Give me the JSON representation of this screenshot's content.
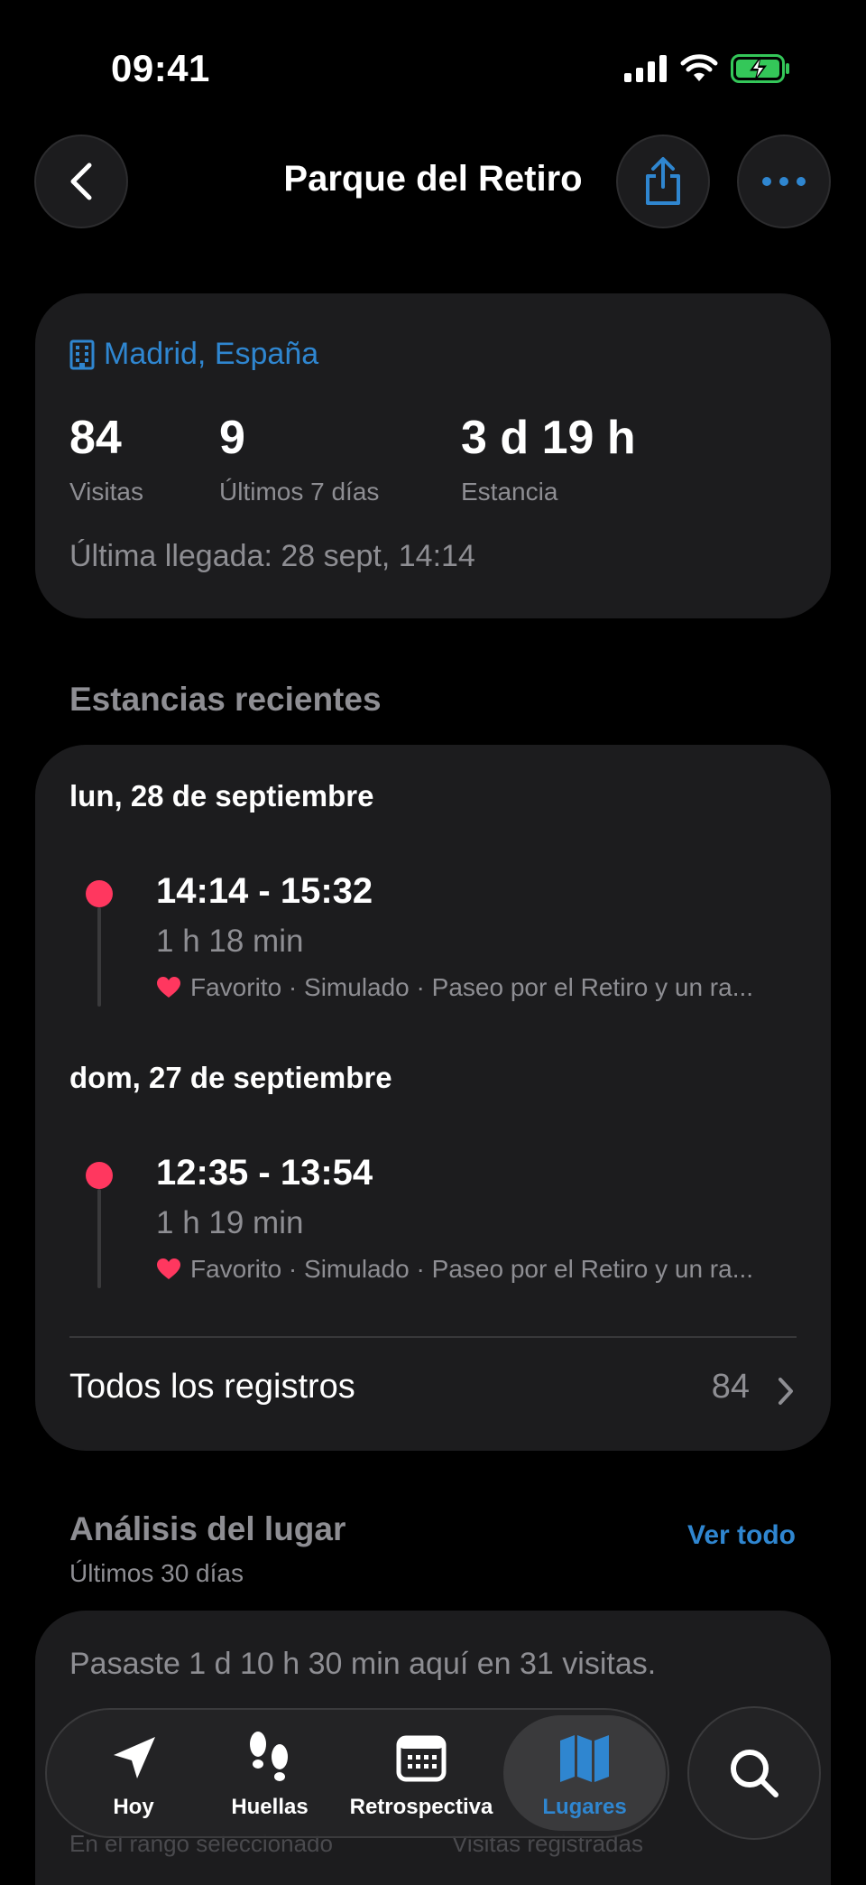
{
  "status_bar": {
    "time": "09:41"
  },
  "nav": {
    "title": "Parque del Retiro"
  },
  "summary": {
    "location": "Madrid, España",
    "stats": [
      {
        "value": "84",
        "label": "Visitas"
      },
      {
        "value": "9",
        "label": "Últimos 7 días"
      },
      {
        "value": "3 d 19 h",
        "label": "Estancia"
      }
    ],
    "last_arrival": "Última llegada: 28 sept, 14:14"
  },
  "recent": {
    "title": "Estancias recientes",
    "days": [
      {
        "label": "lun, 28 de septiembre",
        "range": "14:14 - 15:32",
        "duration": "1 h 18 min",
        "meta": "Favorito · Simulado · Paseo por el Retiro y un ra..."
      },
      {
        "label": "dom, 27 de septiembre",
        "range": "12:35 - 13:54",
        "duration": "1 h 19 min",
        "meta": "Favorito · Simulado · Paseo por el Retiro y un ra..."
      }
    ],
    "all_records_label": "Todos los registros",
    "all_records_count": "84"
  },
  "analysis": {
    "title": "Análisis del lugar",
    "subtitle": "Últimos 30 días",
    "see_all": "Ver todo",
    "summary_text": "Pasaste 1 d 10 h 30 min aquí en 31 visitas.",
    "ghost_left": "En el rango seleccionado",
    "ghost_right": "Visitas registradas"
  },
  "tabbar": {
    "tabs": [
      {
        "label": "Hoy",
        "icon": "location-arrow-icon"
      },
      {
        "label": "Huellas",
        "icon": "footprints-icon"
      },
      {
        "label": "Retrospectiva",
        "icon": "calendar-icon"
      },
      {
        "label": "Lugares",
        "icon": "map-icon"
      }
    ],
    "active": "Lugares"
  },
  "colors": {
    "accent": "#2f86d0",
    "stay_dot": "#ff375f",
    "heart": "#ff375f",
    "battery": "#34c759"
  }
}
